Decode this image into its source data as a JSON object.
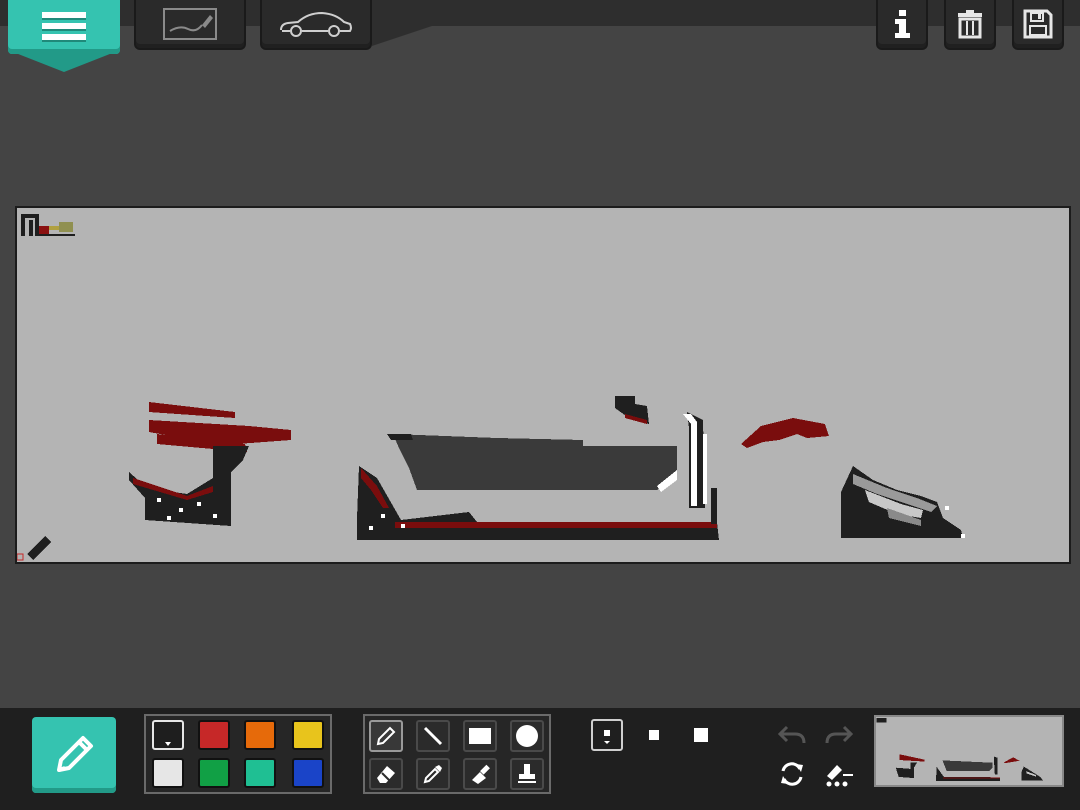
{
  "toolbar_top": {
    "menu_icon": "hamburger-menu-icon",
    "sketch_icon": "sketch-canvas-icon",
    "car_icon": "car-outline-icon",
    "info_icon": "info-icon",
    "trash_icon": "trash-icon",
    "save_icon": "save-floppy-icon"
  },
  "canvas": {
    "background": "#b4b4b4",
    "ink_colors": [
      "#222222",
      "#7a0d0d",
      "#3a3a3a",
      "#ffffff"
    ]
  },
  "palette": [
    {
      "name": "black",
      "hex": "#1e1e1e",
      "selected": true
    },
    {
      "name": "red",
      "hex": "#c62828"
    },
    {
      "name": "orange",
      "hex": "#e66a0a"
    },
    {
      "name": "yellow",
      "hex": "#e8c41c"
    },
    {
      "name": "white",
      "hex": "#e6e6e6"
    },
    {
      "name": "green",
      "hex": "#11a045"
    },
    {
      "name": "teal",
      "hex": "#1fbf93"
    },
    {
      "name": "blue",
      "hex": "#1a44c8"
    }
  ],
  "tools": [
    {
      "name": "pencil",
      "icon": "pencil-icon",
      "active": true
    },
    {
      "name": "line",
      "icon": "line-icon"
    },
    {
      "name": "rectangle",
      "icon": "rectangle-icon"
    },
    {
      "name": "circle",
      "icon": "circle-icon"
    },
    {
      "name": "eraser",
      "icon": "eraser-icon"
    },
    {
      "name": "eyedropper",
      "icon": "eyedropper-icon"
    },
    {
      "name": "fill",
      "icon": "spray-icon"
    },
    {
      "name": "stamp",
      "icon": "stamp-icon"
    }
  ],
  "brush_sizes": [
    "small",
    "medium",
    "large"
  ],
  "selected_brush_size": "small",
  "actions": {
    "undo_icon": "undo-icon",
    "redo_icon": "redo-icon",
    "refresh_icon": "refresh-icon",
    "clear_icon": "clear-drawing-icon"
  }
}
